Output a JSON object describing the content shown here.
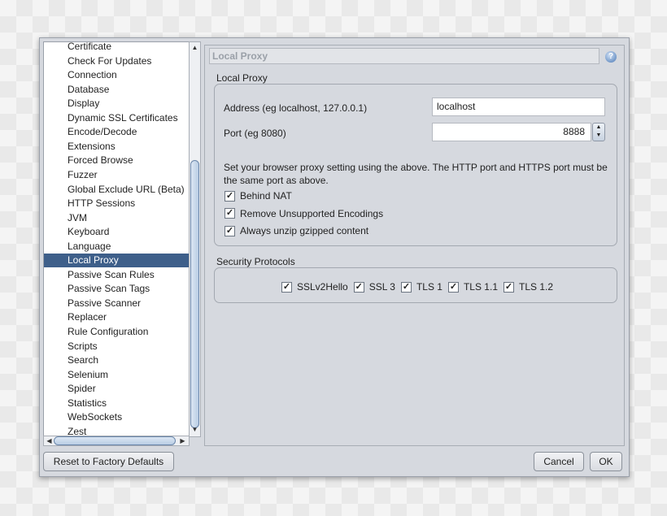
{
  "sidebar": {
    "items": [
      "Certificate",
      "Check For Updates",
      "Connection",
      "Database",
      "Display",
      "Dynamic SSL Certificates",
      "Encode/Decode",
      "Extensions",
      "Forced Browse",
      "Fuzzer",
      "Global Exclude URL (Beta)",
      "HTTP Sessions",
      "JVM",
      "Keyboard",
      "Language",
      "Local Proxy",
      "Passive Scan Rules",
      "Passive Scan Tags",
      "Passive Scanner",
      "Replacer",
      "Rule Configuration",
      "Scripts",
      "Search",
      "Selenium",
      "Spider",
      "Statistics",
      "WebSockets",
      "Zest"
    ],
    "selected": "Local Proxy"
  },
  "panel": {
    "title": "Local Proxy",
    "help_icon": "help-icon",
    "local_proxy": {
      "title": "Local Proxy",
      "address_label": "Address (eg localhost, 127.0.0.1)",
      "address_value": "localhost",
      "port_label": "Port (eg 8080)",
      "port_value": "8888",
      "note": "Set your browser proxy setting using the above. The HTTP port and HTTPS port must be the same port as above.",
      "checkboxes": [
        {
          "label": "Behind NAT",
          "checked": true
        },
        {
          "label": "Remove Unsupported Encodings",
          "checked": true
        },
        {
          "label": "Always unzip gzipped content",
          "checked": true
        }
      ]
    },
    "security": {
      "title": "Security Protocols",
      "protocols": [
        {
          "label": "SSLv2Hello",
          "checked": true
        },
        {
          "label": "SSL 3",
          "checked": true
        },
        {
          "label": "TLS 1",
          "checked": true
        },
        {
          "label": "TLS 1.1",
          "checked": true
        },
        {
          "label": "TLS 1.2",
          "checked": true
        }
      ]
    }
  },
  "footer": {
    "reset": "Reset to Factory Defaults",
    "cancel": "Cancel",
    "ok": "OK"
  },
  "colors": {
    "selection": "#3e5f8a",
    "dialog": "#d6d9df"
  }
}
